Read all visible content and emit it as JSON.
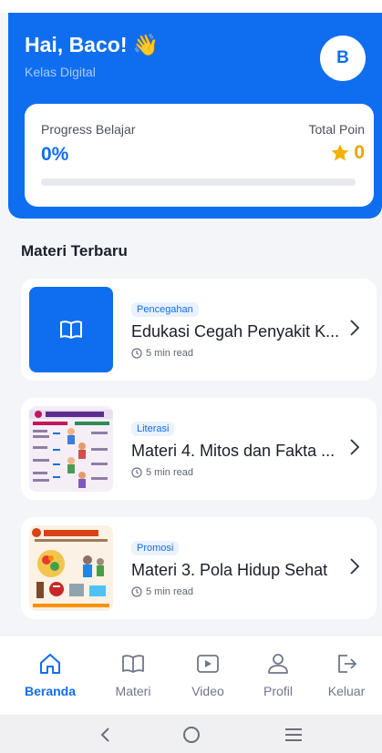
{
  "header": {
    "greeting": "Hai, Baco! 👋",
    "subtitle": "Kelas Digital",
    "avatar_initial": "B"
  },
  "progress": {
    "label": "Progress Belajar",
    "value": "0%",
    "percent": 0,
    "points_label": "Total Poin",
    "points": "0"
  },
  "section": {
    "title": "Materi Terbaru"
  },
  "articles": [
    {
      "tag": "Pencegahan",
      "title": "Edukasi Cegah Penyakit K...",
      "read_time": "5 min read",
      "thumbnail": "book-icon"
    },
    {
      "tag": "Literasi",
      "title": "Materi 4. Mitos dan Fakta ...",
      "read_time": "5 min read",
      "thumbnail": "infographic"
    },
    {
      "tag": "Promosi",
      "title": "Materi 3. Pola Hidup Sehat",
      "read_time": "5 min read",
      "thumbnail": "infographic"
    }
  ],
  "nav": {
    "items": [
      {
        "label": "Beranda",
        "icon": "home-icon",
        "active": true
      },
      {
        "label": "Materi",
        "icon": "book-icon"
      },
      {
        "label": "Video",
        "icon": "play-icon"
      },
      {
        "label": "Profil",
        "icon": "user-icon"
      },
      {
        "label": "Keluar",
        "icon": "logout-icon"
      }
    ]
  },
  "colors": {
    "primary": "#0f6ef0",
    "points": "#e6a400"
  }
}
